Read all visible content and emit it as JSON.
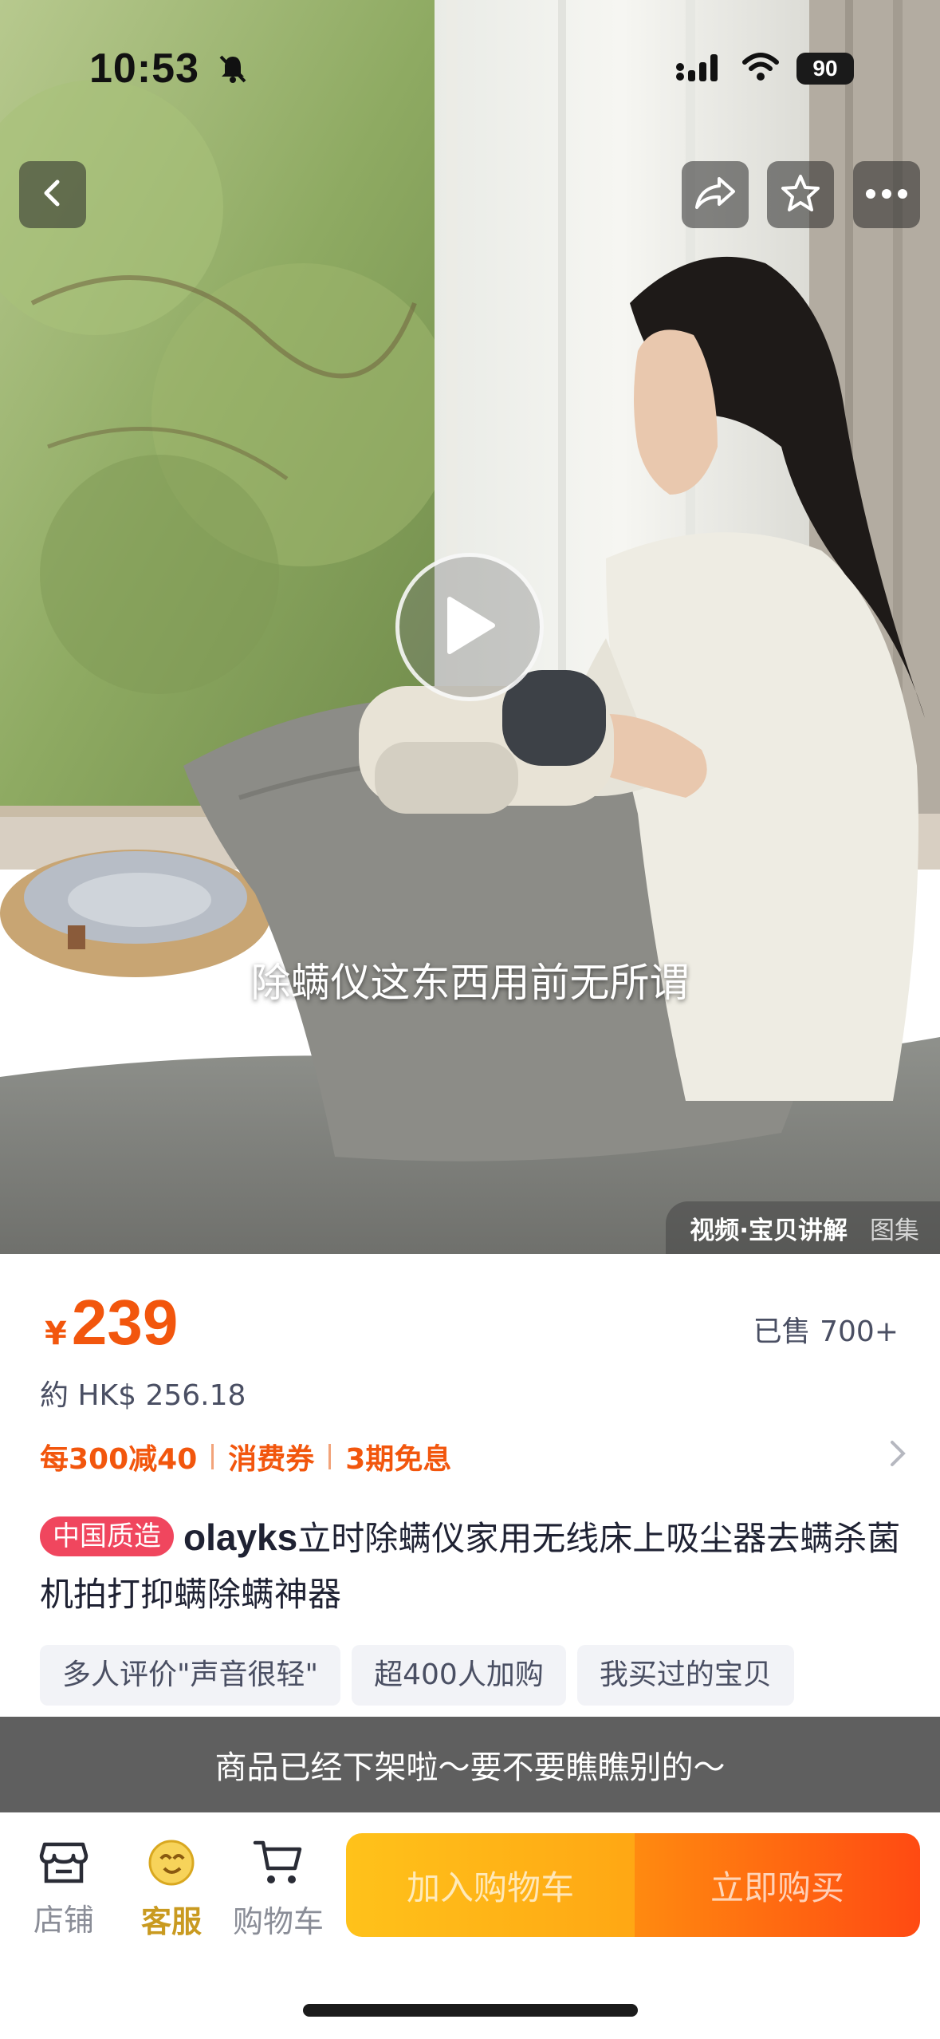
{
  "status_bar": {
    "time": "10:53",
    "battery": "90"
  },
  "media": {
    "subtitle": "除螨仪这东西用前无所谓",
    "tab_active": "视频·宝贝讲解",
    "tab_inactive": "图集"
  },
  "price": {
    "currency": "¥",
    "amount": "239",
    "sold": "已售 700+",
    "hk": "約 HK$ 256.18"
  },
  "promo": {
    "items": [
      "每300减40",
      "消费券",
      "3期免息"
    ]
  },
  "product": {
    "badge": "中国质造",
    "brand": "olayks",
    "title": "立时除螨仪家用无线床上吸尘器去螨杀菌机拍打抑螨除螨神器"
  },
  "chips": [
    "多人评价\"声音很轻\"",
    "超400人加购",
    "我买过的宝贝"
  ],
  "banner": {
    "text": "商品已经下架啦～要不要瞧瞧别的～"
  },
  "bottom_bar": {
    "store": "店铺",
    "service": "客服",
    "cart": "购物车",
    "add_to_cart": "加入购物车",
    "buy_now": "立即购买"
  },
  "colors": {
    "accent": "#f2560d",
    "badge": "#f0465e",
    "gold": "#c99a20"
  },
  "icons": [
    "back-icon",
    "share-icon",
    "star-icon",
    "more-icon",
    "play-icon",
    "muted-bell-icon",
    "signal-icon",
    "wifi-icon",
    "store-icon",
    "service-icon",
    "cart-icon",
    "chevron-right-icon"
  ]
}
